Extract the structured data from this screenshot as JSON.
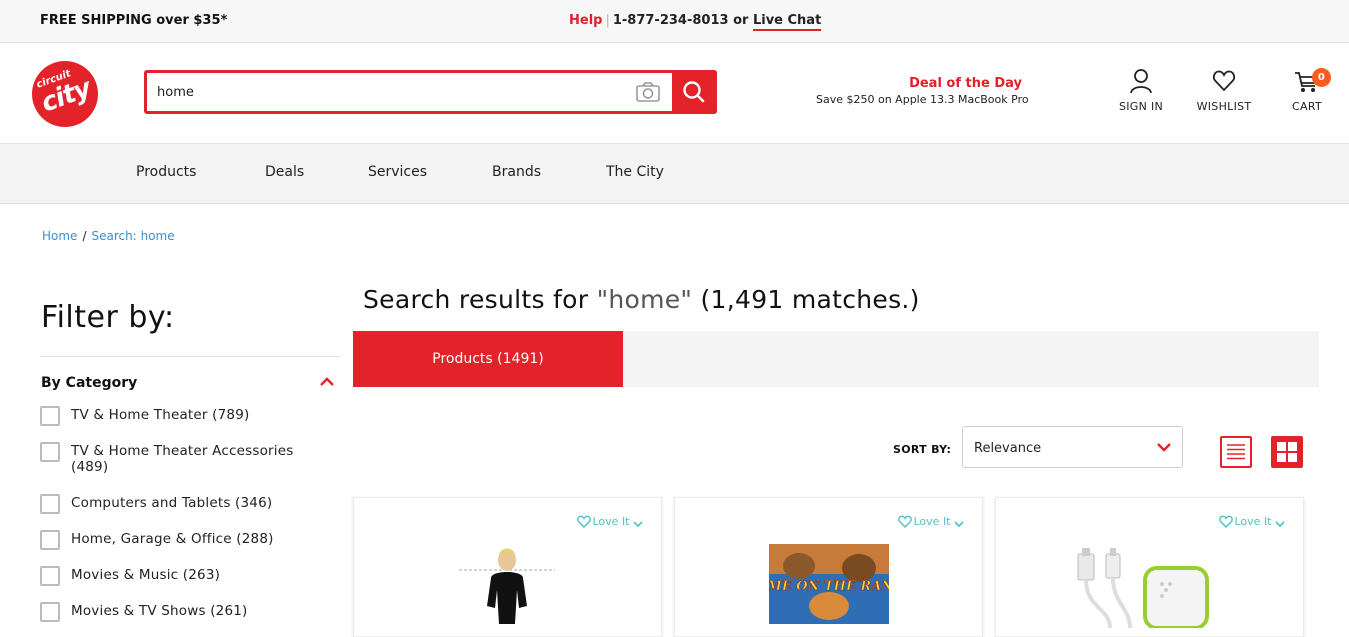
{
  "topbar": {
    "shipping": "FREE SHIPPING over $35*",
    "help": "Help",
    "separator": "|",
    "phone": "1-877-234-8013 or",
    "live_chat": "Live Chat"
  },
  "logo": {
    "line1": "circuit",
    "line2": "city"
  },
  "search": {
    "value": "home",
    "camera_icon": "camera-icon",
    "submit_icon": "search-icon"
  },
  "deal": {
    "title": "Deal of the Day",
    "subtitle": "Save $250 on Apple 13.3 MacBook Pro"
  },
  "header_actions": {
    "signin": "SIGN IN",
    "wishlist": "WISHLIST",
    "cart": "CART",
    "cart_count": "0"
  },
  "nav": [
    "Products",
    "Deals",
    "Services",
    "Brands",
    "The City"
  ],
  "breadcrumb": {
    "home": "Home",
    "separator": "/",
    "current": "Search: home"
  },
  "filter": {
    "title": "Filter by:",
    "category_title": "By Category",
    "categories": [
      "TV & Home Theater (789)",
      "TV & Home Theater Accessories (489)",
      "Computers and Tablets (346)",
      "Home, Garage & Office (288)",
      "Movies & Music (263)",
      "Movies & TV Shows (261)"
    ]
  },
  "results": {
    "prefix": "Search results for ",
    "query": "\"home\"",
    "suffix": " (1,491 matches.)",
    "tab_products": "Products (1491)",
    "sort_label": "SORT BY:",
    "sort_value": "Relevance"
  },
  "cards": [
    {
      "love": "Love It"
    },
    {
      "love": "Love It",
      "image_text": "HOME ON THE RANGE"
    },
    {
      "love": "Love It"
    }
  ],
  "colors": {
    "brand_red": "#e32229",
    "link_blue": "#3a8fd0",
    "teal": "#4bc2c8",
    "badge_orange": "#ff5a1f"
  }
}
